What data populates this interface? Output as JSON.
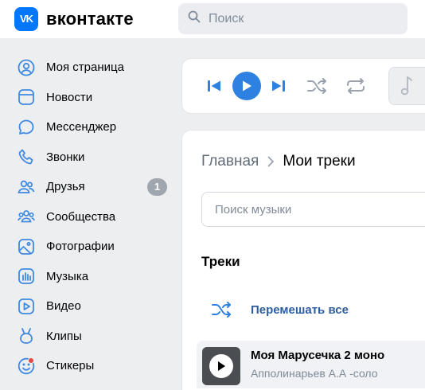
{
  "header": {
    "logo_text": "вконтакте",
    "logo_mark": "VK",
    "search_placeholder": "Поиск"
  },
  "sidebar": {
    "items": [
      {
        "label": "Моя страница",
        "icon": "user-circle-icon"
      },
      {
        "label": "Новости",
        "icon": "news-icon"
      },
      {
        "label": "Мессенджер",
        "icon": "message-bubble-icon"
      },
      {
        "label": "Звонки",
        "icon": "phone-icon"
      },
      {
        "label": "Друзья",
        "icon": "friends-icon",
        "badge": "1"
      },
      {
        "label": "Сообщества",
        "icon": "communities-icon"
      },
      {
        "label": "Фотографии",
        "icon": "photos-icon"
      },
      {
        "label": "Музыка",
        "icon": "music-icon"
      },
      {
        "label": "Видео",
        "icon": "video-icon"
      },
      {
        "label": "Клипы",
        "icon": "clips-icon"
      },
      {
        "label": "Стикеры",
        "icon": "stickers-icon"
      }
    ]
  },
  "player": {
    "controls": [
      "previous-icon",
      "play-icon",
      "next-icon",
      "shuffle-icon",
      "repeat-icon",
      "music-note-icon"
    ]
  },
  "main": {
    "breadcrumb_home": "Главная",
    "breadcrumb_current": "Мои треки",
    "music_search_placeholder": "Поиск музыки",
    "tracks_heading": "Треки",
    "shuffle_all_label": "Перемешать все",
    "tracks": [
      {
        "title": "Моя Марусечка 2 моно",
        "artist": "Апполинарьев А.А -соло"
      }
    ]
  },
  "colors": {
    "accent": "#0077ff",
    "play_button": "#2d81e0",
    "icon_blue": "#3f8ae0",
    "link": "#2d5d9f",
    "page_bg": "#edeef0"
  }
}
